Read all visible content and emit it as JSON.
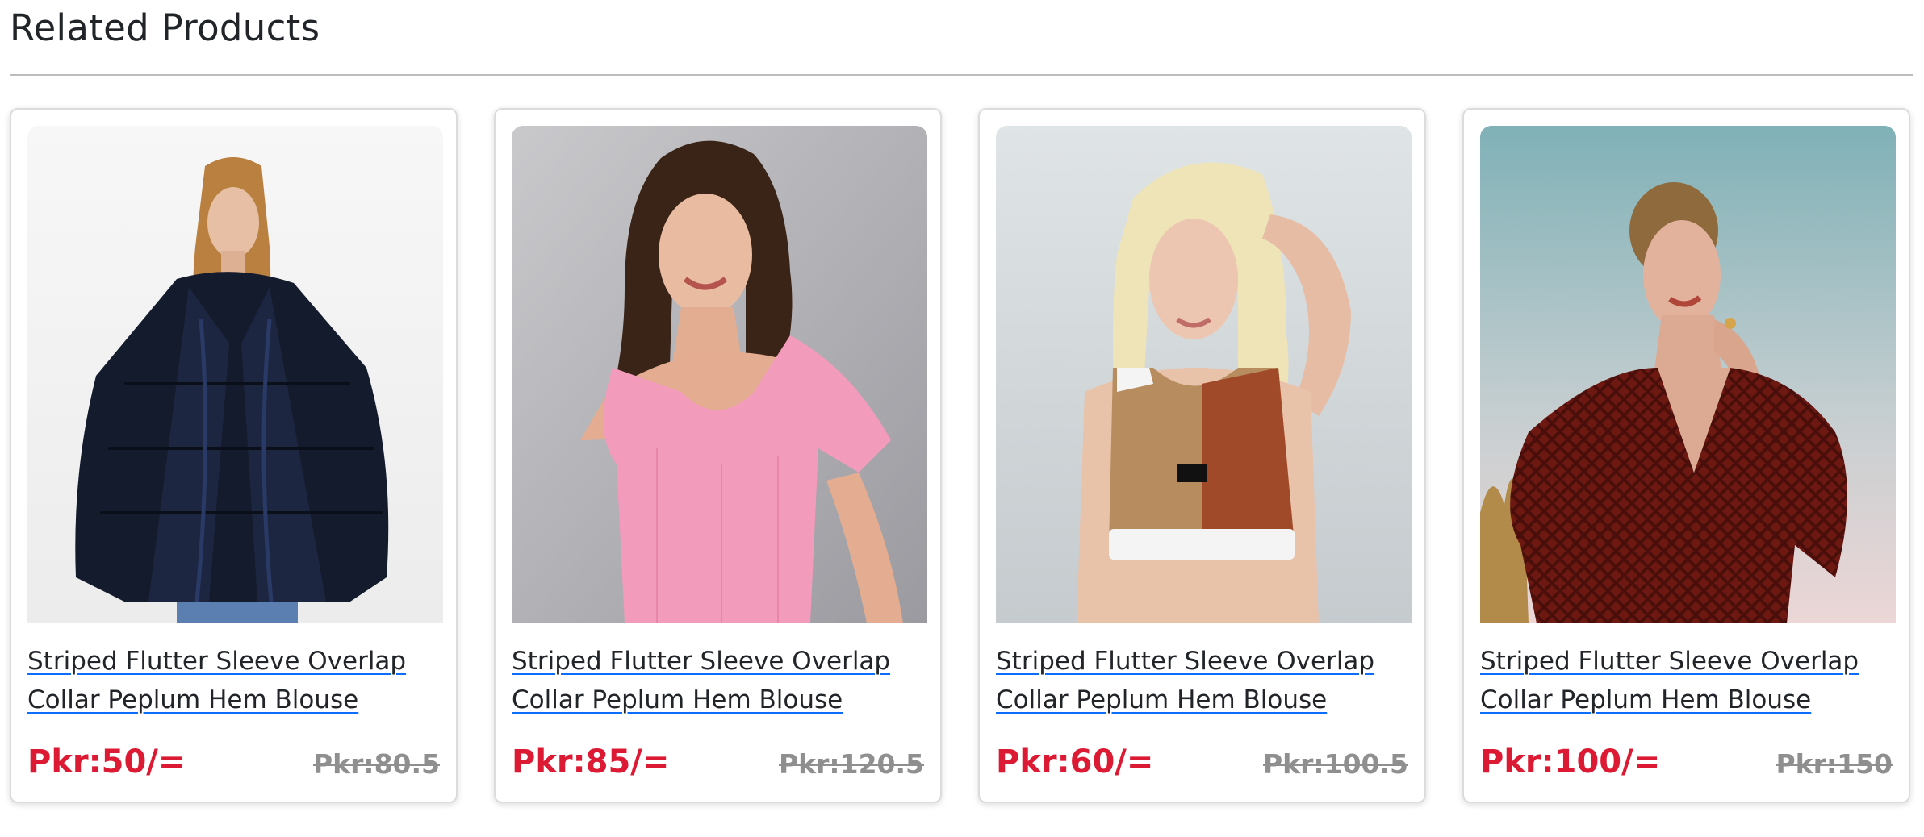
{
  "section": {
    "title": "Related Products"
  },
  "products": [
    {
      "name_line1": "Striped Flutter Sleeve Overlap",
      "name_line2": "Collar Peplum Hem Blouse",
      "price": "Pkr:50/=",
      "old_price": "Pkr:80.5",
      "image": "woman-fur-puffer-jacket-photo"
    },
    {
      "name_line1": "Striped Flutter Sleeve Overlap",
      "name_line2": "Collar Peplum Hem Blouse",
      "price": "Pkr:85/=",
      "old_price": "Pkr:120.5",
      "image": "woman-pink-tshirt-photo"
    },
    {
      "name_line1": "Striped Flutter Sleeve Overlap",
      "name_line2": "Collar Peplum Hem Blouse",
      "price": "Pkr:60/=",
      "old_price": "Pkr:100.5",
      "image": "woman-sports-crop-top-photo"
    },
    {
      "name_line1": "Striped Flutter Sleeve Overlap",
      "name_line2": "Collar Peplum Hem Blouse",
      "price": "Pkr:100/=",
      "old_price": "Pkr:150",
      "image": "woman-red-blouse-photo"
    }
  ],
  "colors": {
    "price": "#dc1a33",
    "old_price": "#8f8f8f",
    "link_underline": "#0d6efd"
  }
}
